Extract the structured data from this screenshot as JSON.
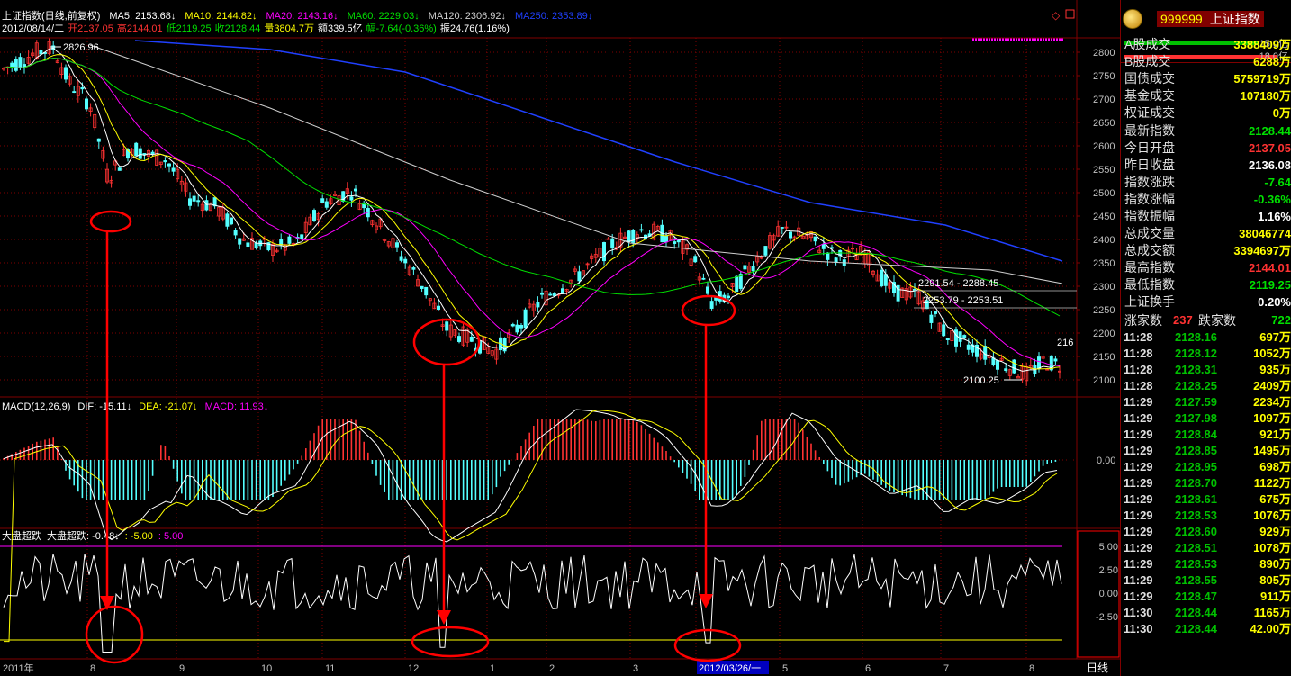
{
  "colors": {
    "up": "#ff3232",
    "down": "#54ffff",
    "ma5": "#ffffff",
    "ma10": "#ffff00",
    "ma20": "#ff00ff",
    "ma60": "#00e000",
    "ma120": "#d0d0d0",
    "ma250": "#2040ff",
    "grid": "#800000",
    "annot": "#ff0000"
  },
  "header": {
    "line1": [
      {
        "text": "上证指数(日线,前复权)",
        "color": "#ffffff"
      },
      {
        "text": "MA5: 2153.68",
        "color": "#ffffff",
        "arrow": "down"
      },
      {
        "text": "MA10: 2144.82",
        "color": "#ffff00",
        "arrow": "down"
      },
      {
        "text": "MA20: 2143.16",
        "color": "#ff00ff",
        "arrow": "down"
      },
      {
        "text": "MA60: 2229.03",
        "color": "#00e000",
        "arrow": "down"
      },
      {
        "text": "MA120: 2306.92",
        "color": "#d0d0d0",
        "arrow": "down"
      },
      {
        "text": "MA250: 2353.89",
        "color": "#2040ff",
        "arrow": "down"
      }
    ],
    "line2": [
      {
        "text": "2012/08/14/二",
        "color": "#ffffff"
      },
      {
        "text": "开2137.05",
        "color": "#ff3232"
      },
      {
        "text": "高2144.01",
        "color": "#ff3232"
      },
      {
        "text": "低2119.25",
        "color": "#00e000"
      },
      {
        "text": "收2128.44",
        "color": "#00e000"
      },
      {
        "text": "量3804.7万",
        "color": "#ffff00"
      },
      {
        "text": "额339.5亿",
        "color": "#ffffff"
      },
      {
        "text": "幅-7.64(-0.36%)",
        "color": "#00e000"
      },
      {
        "text": "振24.76(1.16%)",
        "color": "#ffffff"
      }
    ]
  },
  "price_axis": [
    "2800",
    "2750",
    "2700",
    "2650",
    "2600",
    "2550",
    "2500",
    "2450",
    "2400",
    "2350",
    "2300",
    "2250",
    "2200",
    "2150",
    "2100"
  ],
  "price_annotations": {
    "high": "2826.96",
    "low": "2100.25",
    "right_edge": "216",
    "range1": "2291.54 - 2288.45",
    "range2": "2253.79 - 2253.51"
  },
  "macd": {
    "label": "MACD(12,26,9)",
    "dif": "DIF: -15.11",
    "dea": "DEA: -21.07",
    "macd": "MACD: 11.93",
    "zero": "0.00"
  },
  "indicator": {
    "label": "大盘超跌",
    "value": "大盘超跌: -0.48",
    "low": ": -5.00",
    "high": ": 5.00",
    "axis": [
      "5.00",
      "2.50",
      "0.00",
      "-2.50"
    ]
  },
  "time_axis": [
    "2011年",
    "8",
    "9",
    "10",
    "11",
    "12",
    "1",
    "2",
    "3",
    "2012/03/26/一",
    "5",
    "6",
    "7",
    "8"
  ],
  "period": "日线",
  "right_panel": {
    "code": "999999",
    "name": "上证指数",
    "bar1": "15.0亿",
    "bar2": "18.0亿",
    "volumes": [
      {
        "k": "A股成交",
        "v": "3388409万"
      },
      {
        "k": "B股成交",
        "v": "6288万"
      },
      {
        "k": "国债成交",
        "v": "5759719万"
      },
      {
        "k": "基金成交",
        "v": "107180万"
      },
      {
        "k": "权证成交",
        "v": "0万"
      }
    ],
    "stats": [
      {
        "k": "最新指数",
        "v": "2128.44",
        "c": "#00e000"
      },
      {
        "k": "今日开盘",
        "v": "2137.05",
        "c": "#ff3232"
      },
      {
        "k": "昨日收盘",
        "v": "2136.08",
        "c": "#ffffff"
      },
      {
        "k": "指数涨跌",
        "v": "-7.64",
        "c": "#00e000"
      },
      {
        "k": "指数涨幅",
        "v": "-0.36%",
        "c": "#00e000"
      },
      {
        "k": "指数振幅",
        "v": "1.16%",
        "c": "#ffffff"
      },
      {
        "k": "总成交量",
        "v": "38046774",
        "c": "#ffff00"
      },
      {
        "k": "总成交额",
        "v": "3394697万",
        "c": "#ffff00"
      },
      {
        "k": "最高指数",
        "v": "2144.01",
        "c": "#ff3232"
      },
      {
        "k": "最低指数",
        "v": "2119.25",
        "c": "#00e000"
      },
      {
        "k": "上证换手",
        "v": "0.20%",
        "c": "#ffffff"
      }
    ],
    "updown": {
      "up_label": "涨家数",
      "up": "237",
      "down_label": "跌家数",
      "down": "722"
    },
    "ticks": [
      {
        "t": "11:28",
        "p": "2128.16",
        "v": "697万"
      },
      {
        "t": "11:28",
        "p": "2128.12",
        "v": "1052万"
      },
      {
        "t": "11:28",
        "p": "2128.31",
        "v": "935万"
      },
      {
        "t": "11:28",
        "p": "2128.25",
        "v": "2409万"
      },
      {
        "t": "11:29",
        "p": "2127.59",
        "v": "2234万"
      },
      {
        "t": "11:29",
        "p": "2127.98",
        "v": "1097万"
      },
      {
        "t": "11:29",
        "p": "2128.84",
        "v": "921万"
      },
      {
        "t": "11:29",
        "p": "2128.85",
        "v": "1495万"
      },
      {
        "t": "11:29",
        "p": "2128.95",
        "v": "698万"
      },
      {
        "t": "11:29",
        "p": "2128.70",
        "v": "1122万"
      },
      {
        "t": "11:29",
        "p": "2128.61",
        "v": "675万"
      },
      {
        "t": "11:29",
        "p": "2128.53",
        "v": "1076万"
      },
      {
        "t": "11:29",
        "p": "2128.60",
        "v": "929万"
      },
      {
        "t": "11:29",
        "p": "2128.51",
        "v": "1078万"
      },
      {
        "t": "11:29",
        "p": "2128.53",
        "v": "890万"
      },
      {
        "t": "11:29",
        "p": "2128.55",
        "v": "805万"
      },
      {
        "t": "11:29",
        "p": "2128.47",
        "v": "911万"
      },
      {
        "t": "11:30",
        "p": "2128.44",
        "v": "1165万"
      },
      {
        "t": "11:30",
        "p": "2128.44",
        "v": "42.00万"
      }
    ]
  }
}
